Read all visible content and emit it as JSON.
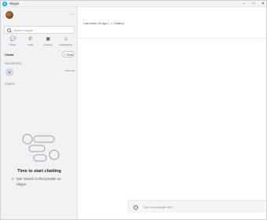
{
  "window": {
    "title": "Skype",
    "controls": [
      "–",
      "□",
      "✕"
    ]
  },
  "sidebar": {
    "profile": {
      "avatar": "user-avatar",
      "more_glyph": "···"
    },
    "search": {
      "placeholder": "Search Skype"
    },
    "nav": [
      {
        "label": "Chats",
        "glyph": "💬",
        "active": true
      },
      {
        "label": "Calls",
        "glyph": "✆",
        "active": false
      },
      {
        "label": "Contacts",
        "glyph": "▣",
        "active": false
      },
      {
        "label": "Notifications",
        "glyph": "♫",
        "active": false
      }
    ],
    "chats_header": {
      "label": "Chats",
      "chevron": "⌄",
      "chat_button_label": "Chat",
      "chat_button_glyph": "+"
    },
    "favorites_label": "FAVORITES",
    "favorite_item": {
      "avatar_text": "●",
      "time": "12:40 AM"
    },
    "chats_section_label": "CHATS",
    "empty_state": {
      "title": "Time to start chatting",
      "hint": "Use Search to find people on Skype."
    }
  },
  "main": {
    "last_seen": "Last seen 2h ago  |  ☺ Gallery",
    "compose_placeholder": "Type a message here"
  },
  "colors": {
    "accent": "#0078d4",
    "sidebar_bg": "#f1f2f4",
    "brand": "#00aff0"
  }
}
